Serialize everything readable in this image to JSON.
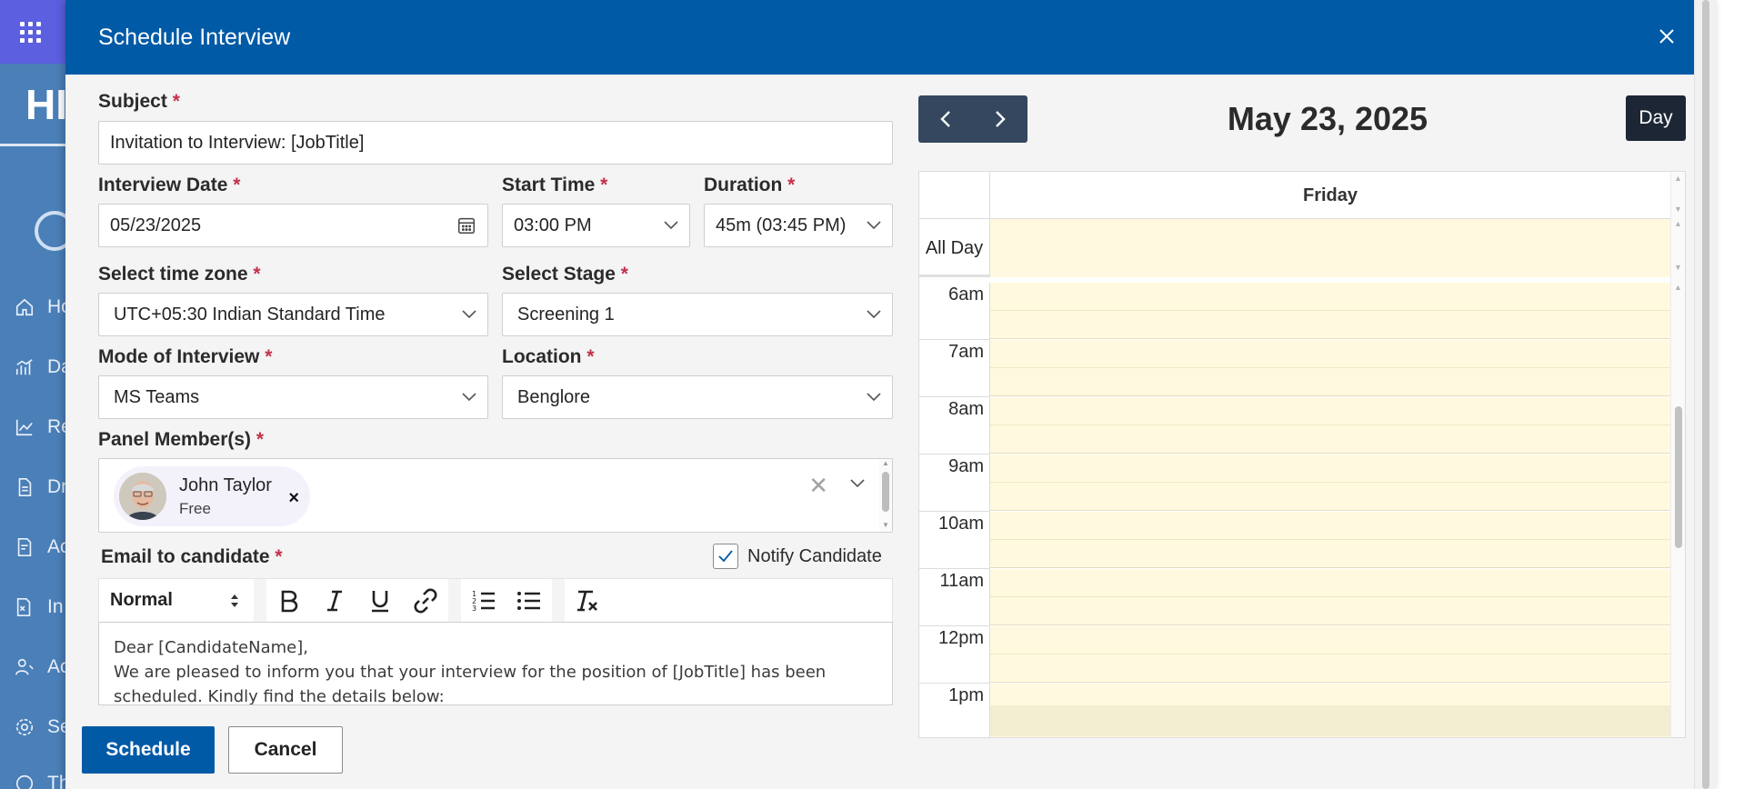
{
  "background_app": {
    "brand": "HI",
    "nav": [
      {
        "label": "Ho",
        "icon": "home-icon"
      },
      {
        "label": "Da",
        "icon": "dashboard-icon"
      },
      {
        "label": "Re",
        "icon": "reports-icon"
      },
      {
        "label": "Dr",
        "icon": "drafts-icon"
      },
      {
        "label": "Ac",
        "icon": "activity-icon"
      },
      {
        "label": "In",
        "icon": "inbox-icon"
      },
      {
        "label": "Ac",
        "icon": "access-icon"
      },
      {
        "label": "Se",
        "icon": "settings-icon"
      },
      {
        "label": "Th",
        "icon": "theme-icon"
      }
    ]
  },
  "modal": {
    "title": "Schedule Interview",
    "close_icon": "close-icon"
  },
  "form": {
    "required_mark": "*",
    "subject": {
      "label": "Subject",
      "value": "Invitation to Interview: [JobTitle]"
    },
    "interview_date": {
      "label": "Interview Date",
      "value": "05/23/2025"
    },
    "start_time": {
      "label": "Start Time",
      "value": "03:00 PM"
    },
    "duration": {
      "label": "Duration",
      "value": "45m (03:45 PM)"
    },
    "time_zone": {
      "label": "Select time zone",
      "value": "UTC+05:30 Indian Standard Time"
    },
    "stage": {
      "label": "Select Stage",
      "value": "Screening 1"
    },
    "mode": {
      "label": "Mode of Interview",
      "value": "MS Teams"
    },
    "location": {
      "label": "Location",
      "value": "Benglore"
    },
    "panel": {
      "label": "Panel Member(s)",
      "members": [
        {
          "name": "John Taylor",
          "status": "Free"
        }
      ],
      "remove_glyph": "×",
      "clear_glyph": "✕"
    },
    "email": {
      "label": "Email to candidate",
      "notify_label": "Notify Candidate",
      "notify_checked": true,
      "toolbar": {
        "format_value": "Normal",
        "buttons": [
          "bold-icon",
          "italic-icon",
          "underline-icon",
          "link-icon",
          "ordered-list-icon",
          "bullet-list-icon",
          "clear-format-icon"
        ]
      },
      "body_lines": [
        "Dear [CandidateName],",
        " We are pleased to inform you that your interview for the position of [JobTitle] has been",
        "scheduled. Kindly find the details below:"
      ]
    }
  },
  "actions": {
    "schedule_label": "Schedule",
    "cancel_label": "Cancel"
  },
  "calendar": {
    "date_title": "May 23, 2025",
    "view_label": "Day",
    "day_name": "Friday",
    "all_day_label": "All Day",
    "hours": [
      "6am",
      "7am",
      "8am",
      "9am",
      "10am",
      "11am",
      "12pm",
      "1pm"
    ],
    "event_bg_color": "#fff9df"
  },
  "colors": {
    "header": "#005aa6",
    "primary": "#005aa6",
    "required": "#c4314b",
    "nav_dark": "#34475f"
  }
}
